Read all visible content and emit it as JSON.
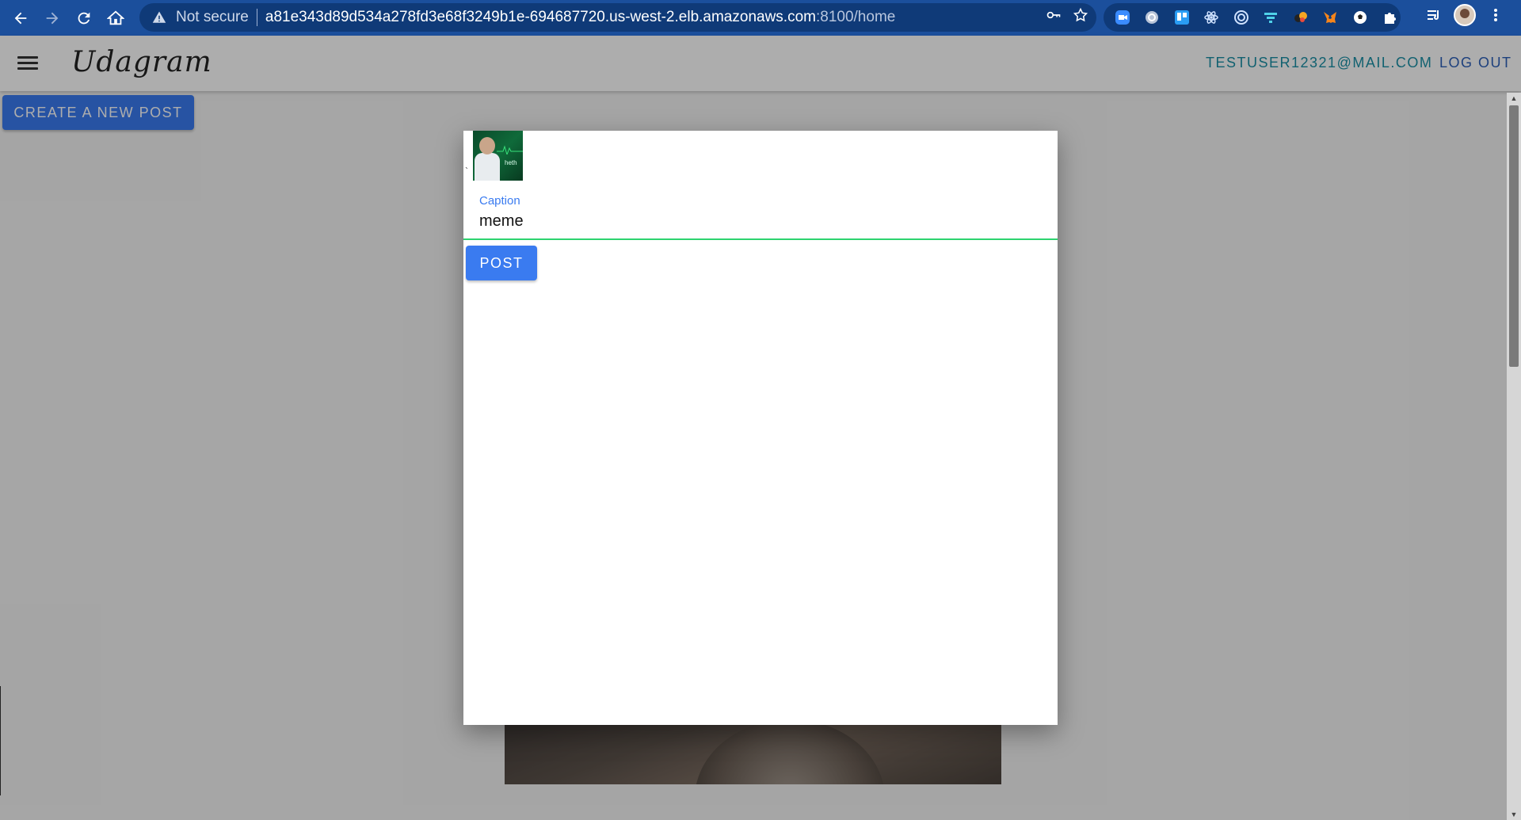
{
  "browser": {
    "security_label": "Not secure",
    "url_host": "a81e343d89d534a278fd3e68f3249b1e-694687720.us-west-2.elb.amazonaws.com",
    "url_path": ":8100/home"
  },
  "app": {
    "brand": "Udagram",
    "user_email": "TESTUSER12321@MAIL.COM",
    "logout_label": "LOG OUT",
    "create_post_label": "CREATE A NEW POST"
  },
  "modal": {
    "preview_marker": "`",
    "preview_image_text": "heth",
    "caption_label": "Caption",
    "caption_value": "meme",
    "post_label": "POST"
  },
  "colors": {
    "chrome": "#1b4f9c",
    "primary": "#3a7bf0",
    "input_focus": "#2dd36f",
    "email": "#1a8fa6"
  }
}
